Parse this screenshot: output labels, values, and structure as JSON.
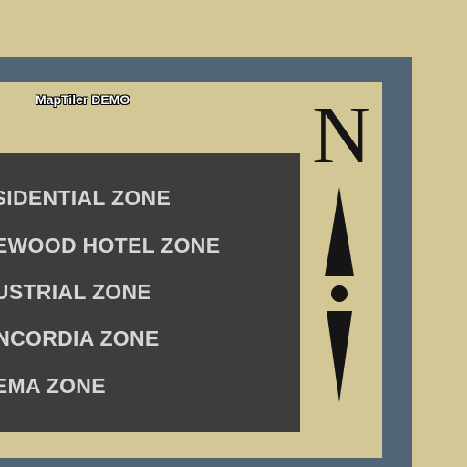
{
  "map": {
    "watermark": "MapTiler DEMO",
    "legend": {
      "zones": [
        "ESIDENTIAL ZONE",
        "NEWOOD HOTEL ZONE",
        "DUSTRIAL ZONE",
        "ONCORDIA ZONE",
        "NEMA ZONE"
      ]
    },
    "north_arrow": {
      "letter": "N",
      "icon": "north-arrow-icon"
    }
  },
  "colors": {
    "background": "#d2c795",
    "frame": "#526575",
    "legend_box": "#3d3d3c",
    "legend_text": "#d6d6d6",
    "compass": "#151515"
  }
}
